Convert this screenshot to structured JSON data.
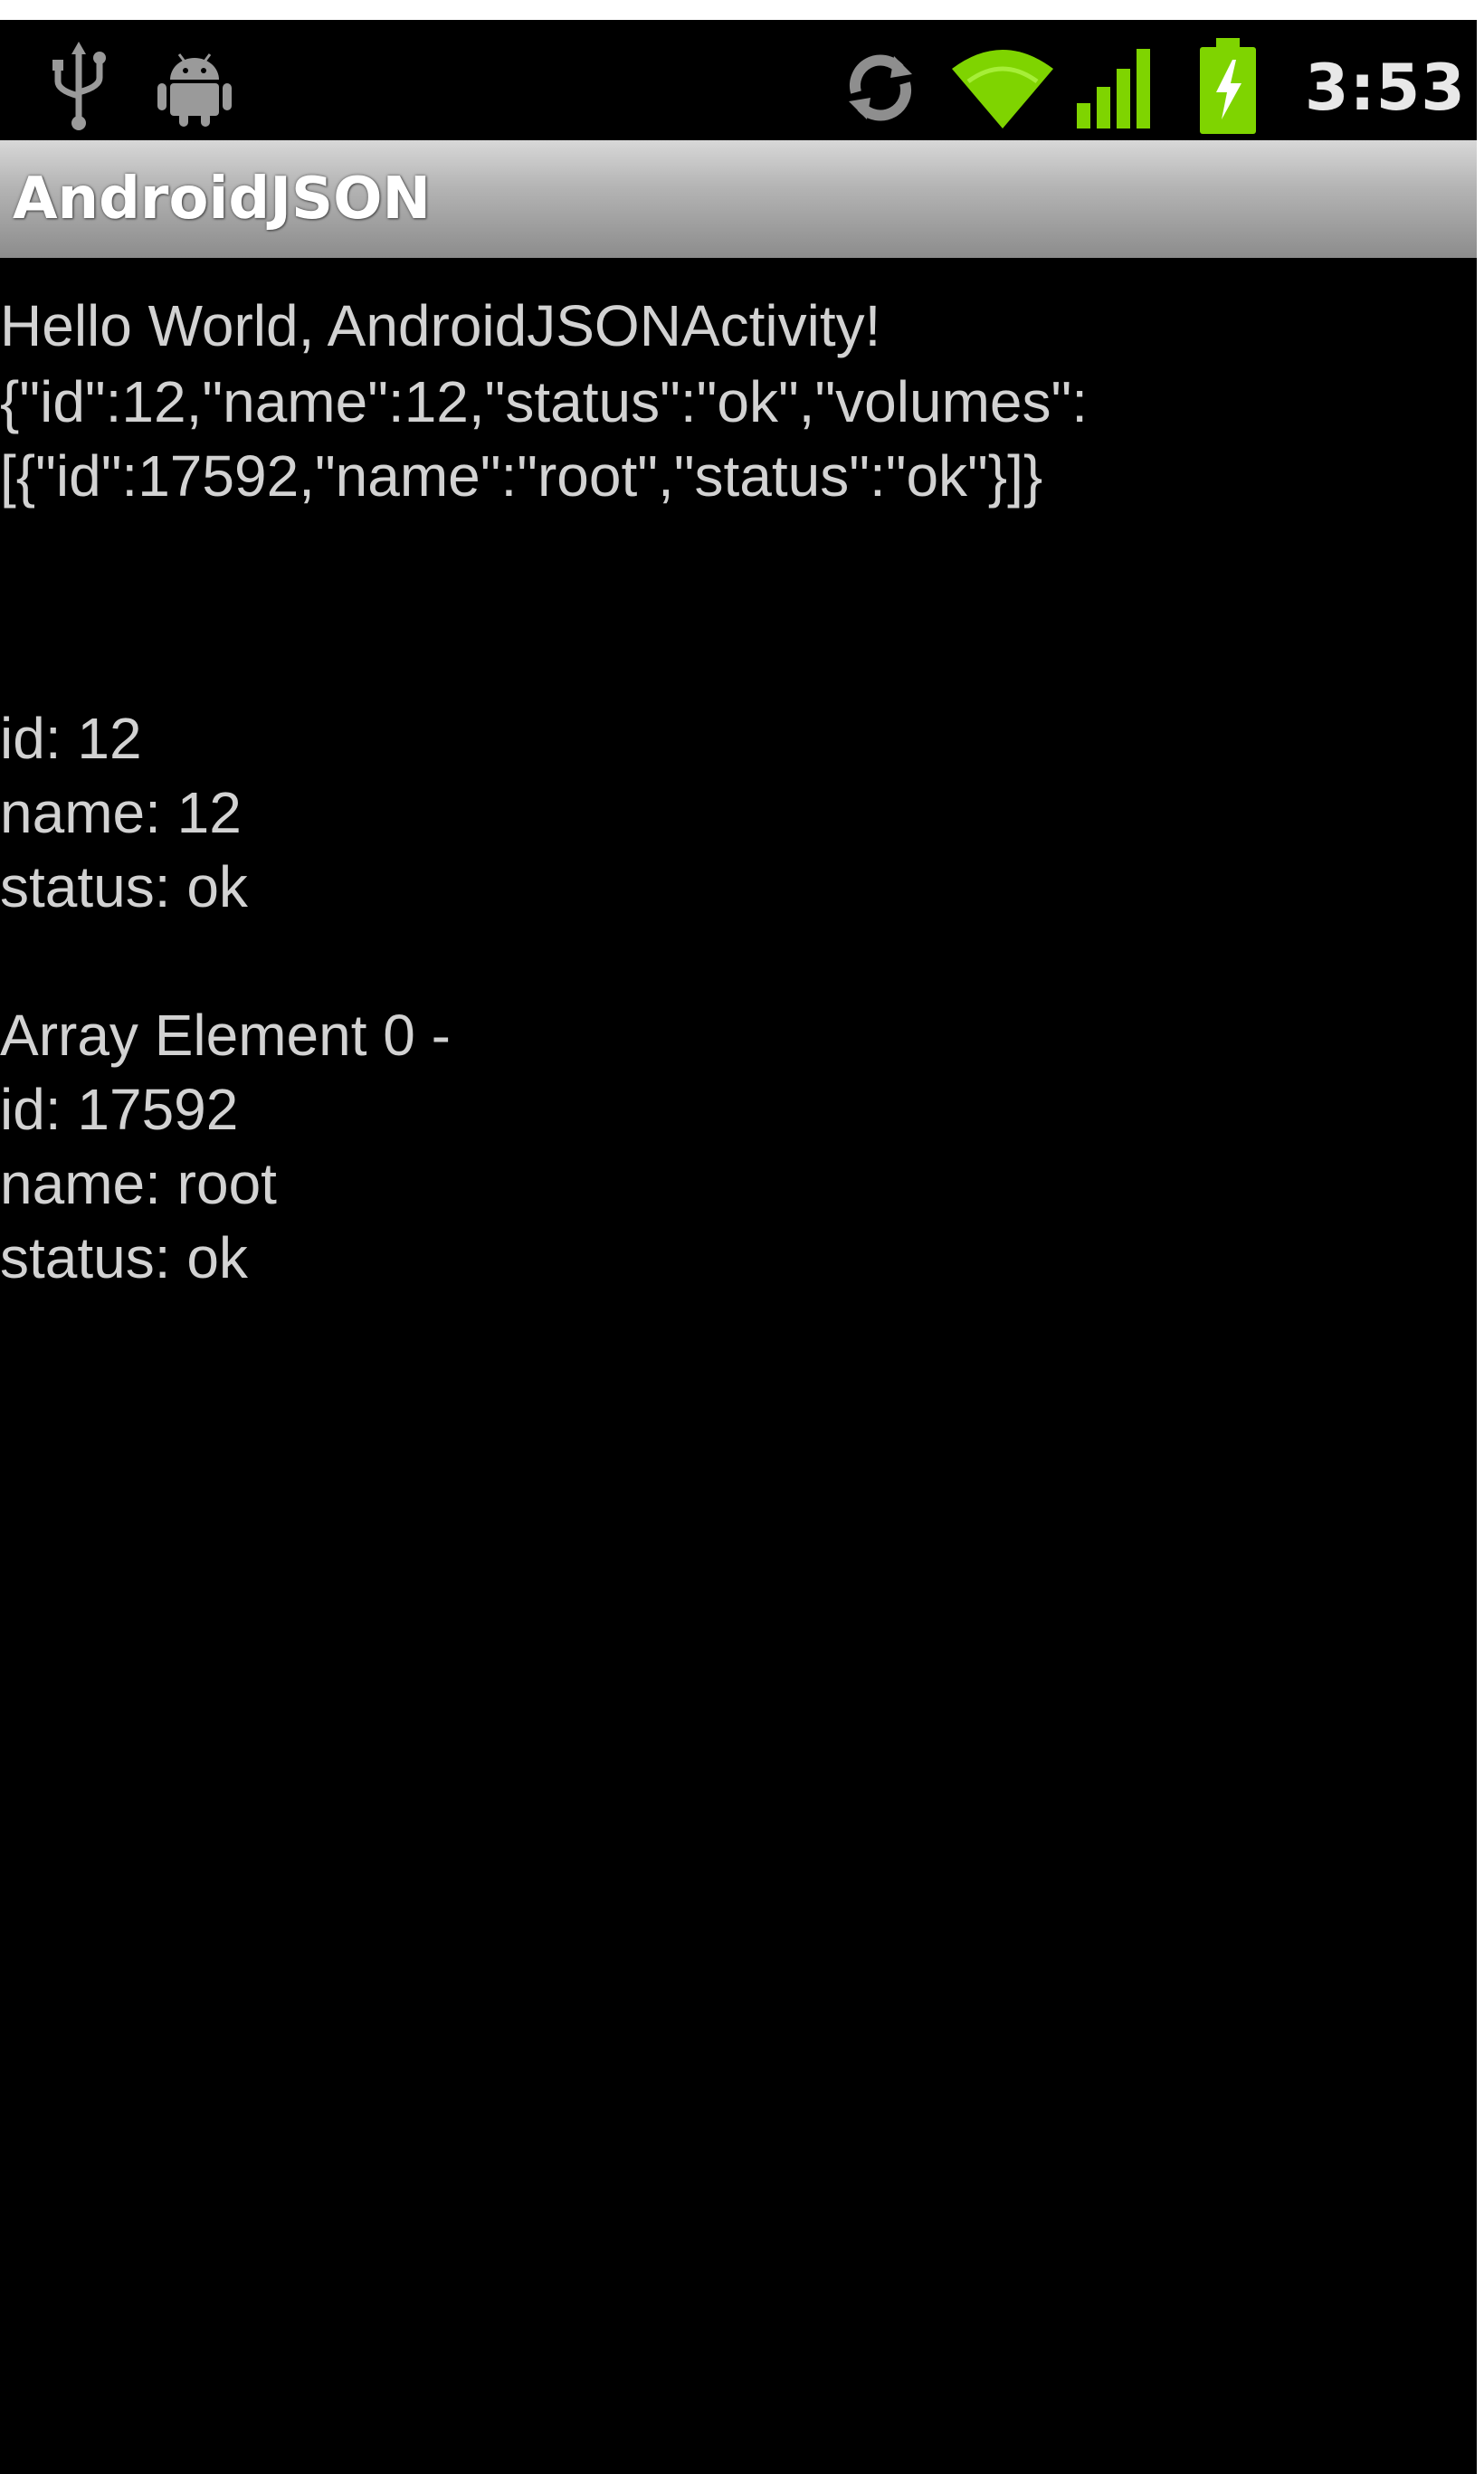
{
  "status_bar": {
    "time": "3:53",
    "icons": [
      "usb-icon",
      "android-debug-icon",
      "sync-icon",
      "wifi-icon",
      "signal-icon",
      "battery-charging-icon"
    ],
    "colors": {
      "wifi": "#7fd400",
      "signal": "#7fd400",
      "battery": "#7fd400"
    }
  },
  "title_bar": {
    "title": "AndroidJSON"
  },
  "content": {
    "greeting": "Hello World, AndroidJSONActivity!",
    "json_line_1": "{\"id\":12,\"name\":12,\"status\":\"ok\",\"volumes\":",
    "json_line_2": "[{\"id\":17592,\"name\":\"root\",\"status\":\"ok\"}]}",
    "id": "id: 12",
    "name": "name: 12",
    "status": "status: ok",
    "array_header": "Array Element 0 -",
    "array_id": "id: 17592",
    "array_name": "name: root",
    "array_status": "status: ok"
  }
}
